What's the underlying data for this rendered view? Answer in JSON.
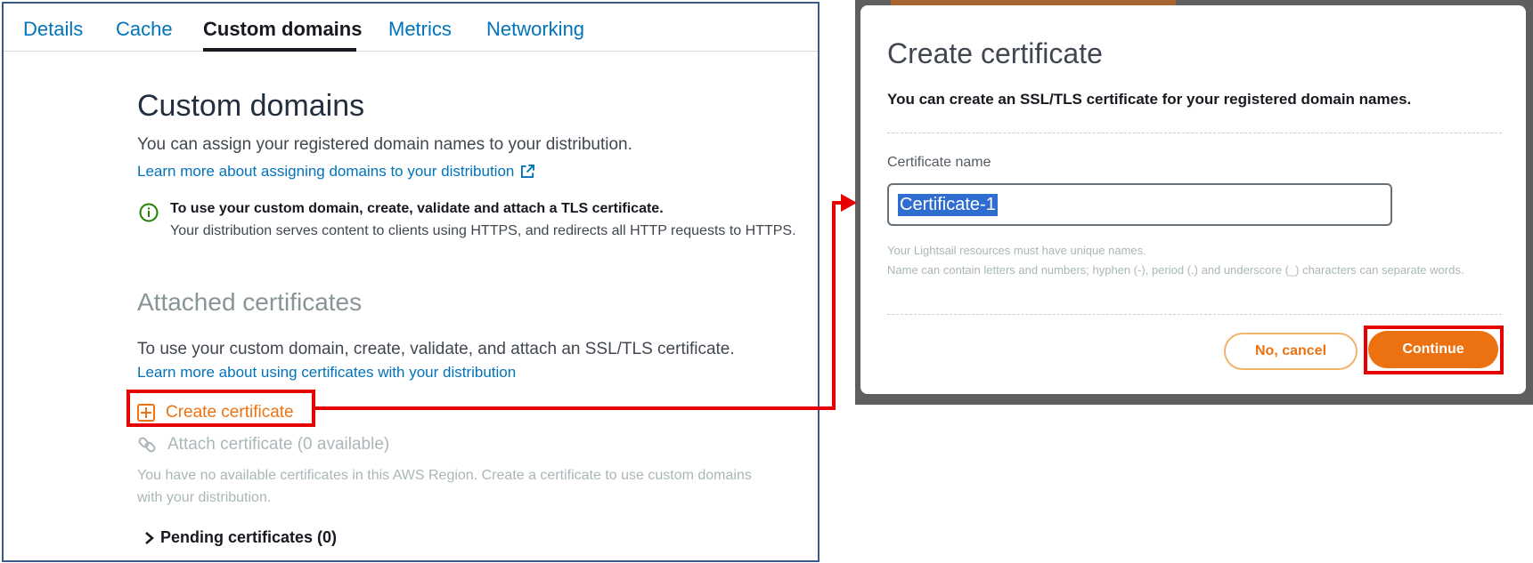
{
  "tabs": [
    {
      "label": "Details"
    },
    {
      "label": "Cache"
    },
    {
      "label": "Custom domains"
    },
    {
      "label": "Metrics"
    },
    {
      "label": "Networking"
    }
  ],
  "active_tab": "Custom domains",
  "custom_domains": {
    "title": "Custom domains",
    "description": "You can assign your registered domain names to your distribution.",
    "learn_more": "Learn more about assigning domains to your distribution",
    "info_title": "To use your custom domain, create, validate and attach a TLS certificate.",
    "info_text": "Your distribution serves content to clients using HTTPS, and redirects all HTTP requests to HTTPS."
  },
  "attached_certificates": {
    "title": "Attached certificates",
    "description": "To use your custom domain, create, validate, and attach an SSL/TLS certificate.",
    "learn_more": "Learn more about using certificates with your distribution",
    "create_label": "Create certificate",
    "attach_label": "Attach certificate (0 available)",
    "no_certs_text": "You have no available certificates in this AWS Region. Create a certificate to use custom domains with your distribution.",
    "pending_label": "Pending certificates (0)"
  },
  "dialog": {
    "title": "Create certificate",
    "subtitle": "You can create an SSL/TLS certificate for your registered domain names.",
    "field_label": "Certificate name",
    "field_value": "Certificate-1",
    "hint_line1": "Your Lightsail resources must have unique names.",
    "hint_line2": "Name can contain letters and numbers; hyphen (-), period (.) and underscore (_) characters can separate words.",
    "cancel_label": "No, cancel",
    "continue_label": "Continue"
  },
  "colors": {
    "link": "#0073bb",
    "accent": "#ec7211",
    "highlight": "#e60000",
    "muted": "#aab7b8"
  }
}
